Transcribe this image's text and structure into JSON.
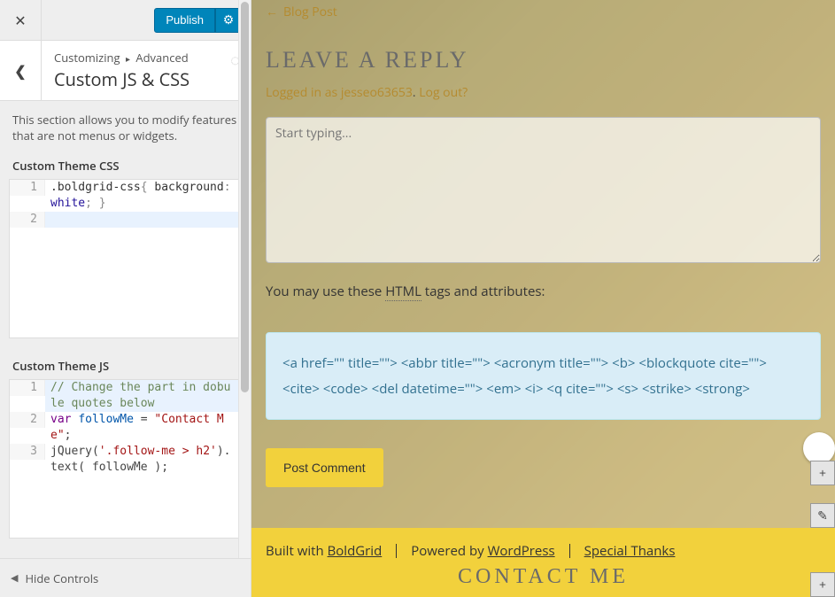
{
  "sidebar": {
    "publish_label": "Publish",
    "breadcrumb_root": "Customizing",
    "breadcrumb_section": "Advanced",
    "section_title": "Custom JS & CSS",
    "description": "This section allows you to modify features that are not menus or widgets.",
    "css_label": "Custom Theme CSS",
    "js_label": "Custom Theme JS",
    "hide_controls": "Hide Controls",
    "css_lines": {
      "l1": ".boldgrid-css{ background: white; }",
      "l2": ""
    },
    "js_lines": {
      "l1": "// Change the part in dobule quotes below",
      "l2": "var followMe = \"Contact Me\";",
      "l3": "jQuery('.follow-me > h2').text( followMe );"
    }
  },
  "preview": {
    "back_link": "Blog Post",
    "reply_title": "LEAVE A REPLY",
    "logged_in_prefix": "Logged in as ",
    "username": "jesseo63653",
    "logout": "Log out?",
    "comment_placeholder": "Start typing...",
    "mayuse_pre": "You may use these ",
    "html_abbr": "HTML",
    "mayuse_post": " tags and attributes:",
    "tags": "<a href=\"\" title=\"\"> <abbr title=\"\"> <acronym title=\"\"> <b> <blockquote cite=\"\"> <cite> <code> <del datetime=\"\"> <em> <i> <q cite=\"\"> <s> <strike> <strong>",
    "post_comment": "Post Comment",
    "footer": {
      "built": "Built with ",
      "boldgrid": "BoldGrid",
      "powered": "Powered by ",
      "wordpress": "WordPress",
      "thanks": "Special Thanks",
      "contact": "CONTACT ME"
    }
  }
}
